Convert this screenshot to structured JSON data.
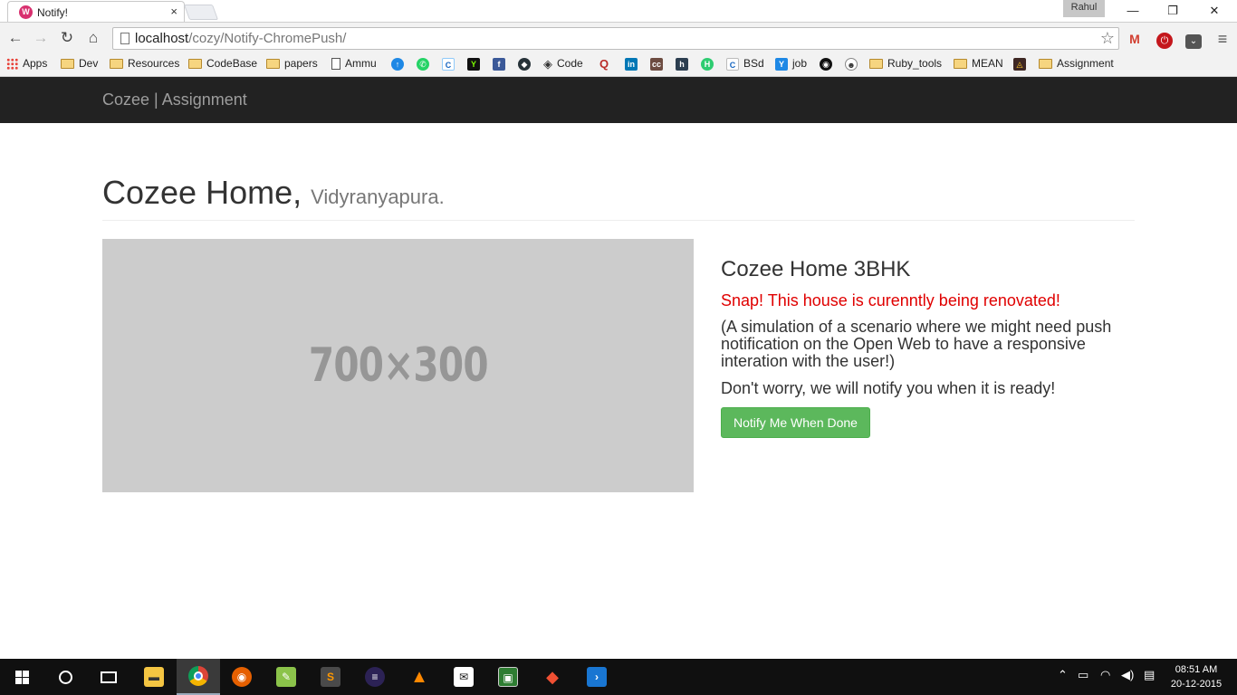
{
  "browser": {
    "tab_title": "Notify!",
    "tab_close": "×",
    "profile_name": "Rahul",
    "window_controls": {
      "minimize": "—",
      "restore": "❐",
      "close": "✕"
    },
    "address": {
      "host": "localhost",
      "path": "/cozy/Notify-ChromePush/"
    },
    "bookmarks": [
      {
        "label": "Apps",
        "icon": "apps-grid-icon"
      },
      {
        "label": "Dev",
        "icon": "folder-icon"
      },
      {
        "label": "Resources",
        "icon": "folder-icon"
      },
      {
        "label": "CodeBase",
        "icon": "folder-icon"
      },
      {
        "label": "papers",
        "icon": "folder-icon"
      },
      {
        "label": "Ammu",
        "icon": "page-icon"
      },
      {
        "label": "Code",
        "icon": "code-icon"
      },
      {
        "label": "BSd",
        "icon": "c-icon"
      },
      {
        "label": "job",
        "icon": "job-icon"
      },
      {
        "label": "Ruby_tools",
        "icon": "folder-icon"
      },
      {
        "label": "MEAN",
        "icon": "folder-icon"
      },
      {
        "label": "Assignment",
        "icon": "folder-icon"
      }
    ]
  },
  "navbar": {
    "brand": "Cozee | Assignment"
  },
  "header": {
    "title": "Cozee Home,",
    "subtitle": "Vidyranyapura."
  },
  "image_placeholder": {
    "text": "700×300"
  },
  "listing": {
    "title": "Cozee Home 3BHK",
    "alert": "Snap! This house is curenntly being renovated!",
    "description": "(A simulation of a scenario where we might need push notification on the Open Web to have a responsive interation with the user!)",
    "reassurance": "Don't worry, we will notify you when it is ready!",
    "button_label": "Notify Me When Done",
    "alert_color": "#e00000",
    "button_color": "#5cb85c"
  },
  "taskbar": {
    "time": "08:51 AM",
    "date": "20-12-2015"
  }
}
